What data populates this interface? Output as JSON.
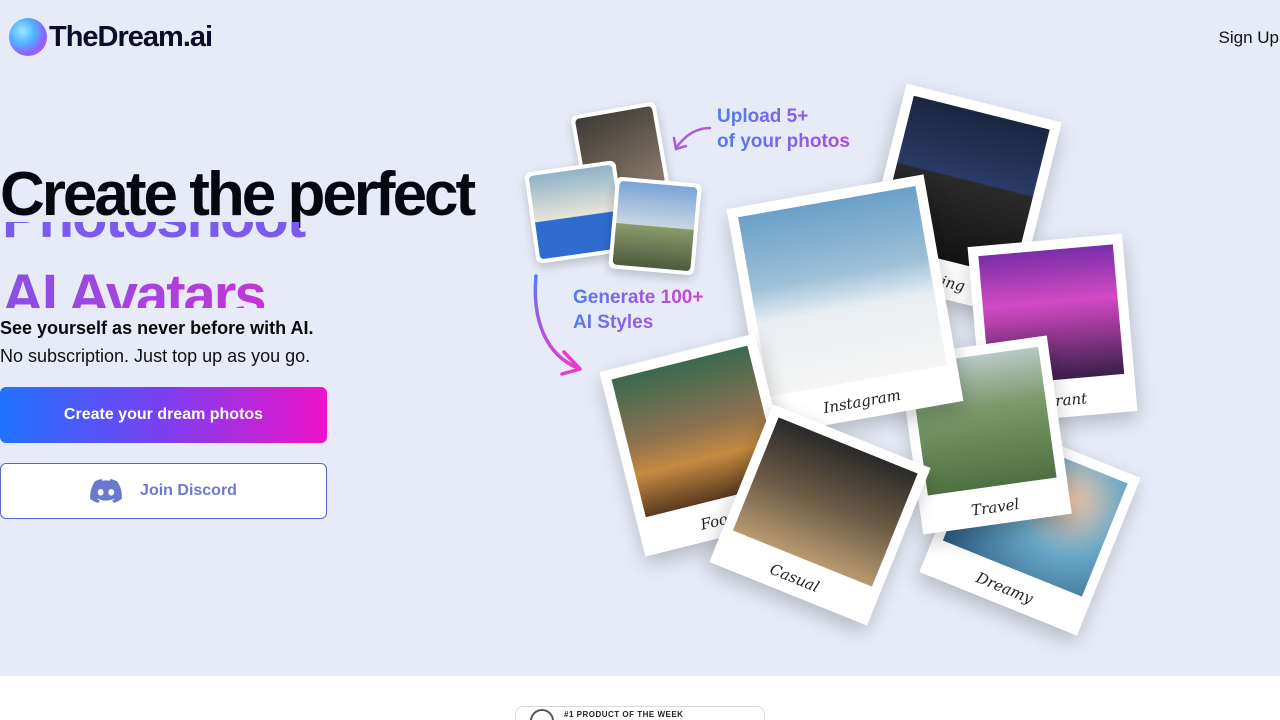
{
  "header": {
    "brand": "TheDream.ai",
    "signup_label": "Sign Up"
  },
  "hero": {
    "headline": "Create the perfect",
    "rotating_words": [
      "Photoshoot",
      "AI Avatars"
    ],
    "tagline_bold": "See yourself as never before with AI.",
    "tagline": "No subscription. Just top up as you go.",
    "cta_primary": "Create your dream photos",
    "cta_discord": "Join Discord"
  },
  "collage": {
    "upload_callout": [
      "Upload 5+",
      "of your photos"
    ],
    "generate_callout": [
      "Generate 100+",
      "AI Styles"
    ],
    "styles": [
      "Dating",
      "Instagram",
      "Vibrant",
      "Food",
      "Casual",
      "Travel",
      "Dreamy"
    ]
  },
  "badge": {
    "text": "#1 PRODUCT OF THE WEEK"
  },
  "colors": {
    "background": "#e6ebf7",
    "gradient_start": "#1f72ff",
    "gradient_end": "#ee12c9",
    "discord": "#5865f2"
  }
}
